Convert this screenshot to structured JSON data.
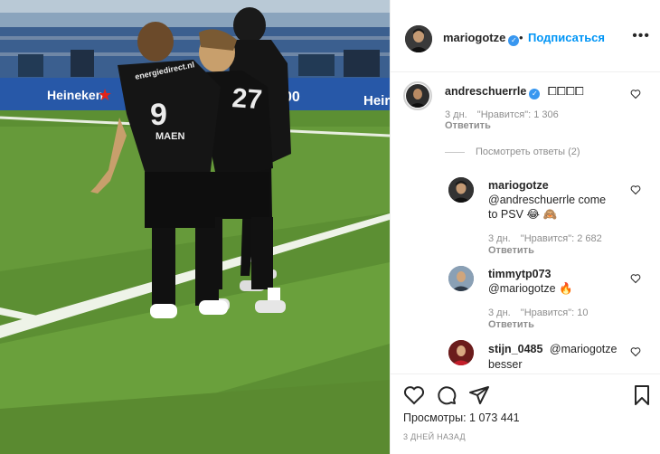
{
  "header": {
    "username": "mariogotze",
    "dot": "•",
    "follow_label": "Подписаться",
    "more_label": "•••"
  },
  "media": {
    "ad_board_1": "Heineken",
    "ad_board_2": "Heir",
    "ad_board_3": "00",
    "shirt_sponsor": "energiedirect.nl",
    "player_1_number": "9",
    "player_1_name": "MAEN",
    "player_2_number": "27"
  },
  "comments": [
    {
      "username": "andreschuerrle",
      "text": "⧠⧠⧠⧠",
      "time": "3 дн.",
      "likes": "\"Нравится\": 1 306",
      "reply_label": "Ответить"
    }
  ],
  "view_replies_label": "Посмотреть ответы (2)",
  "replies": [
    {
      "username": "mariogotze",
      "text_line1": "@andreschuerrle come",
      "text_line2": "to PSV 😂 🙈",
      "time": "3 дн.",
      "likes": "\"Нравится\": 2 682",
      "reply_label": "Ответить"
    },
    {
      "username": "timmytp073",
      "text_line1": "@mariogotze 🔥",
      "time": "3 дн.",
      "likes": "\"Нравится\": 10",
      "reply_label": "Ответить"
    },
    {
      "username": "stijn_0485",
      "text_line1": "@mariogotze",
      "text_line2": "besser"
    }
  ],
  "footer": {
    "views": "Просмотры: 1 073 441",
    "date": "3 ДНЕЙ НАЗАД"
  },
  "colors": {
    "link": "#0095f6",
    "verified": "#3897f0",
    "muted": "#8e8e8e",
    "pitch": "#5c8f33"
  }
}
